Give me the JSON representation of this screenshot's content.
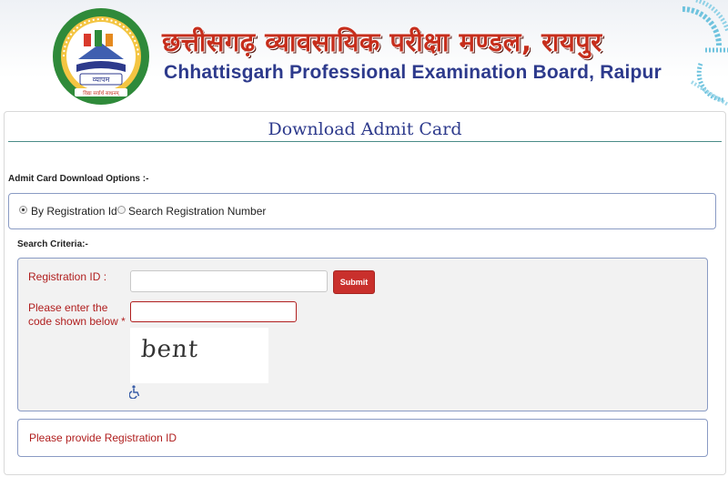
{
  "header": {
    "hindi_title": "छत्तीसगढ़ व्यावसायिक परीक्षा मण्डल, रायपुर",
    "english_title": "Chhattisgarh Professional Examination Board, Raipur",
    "logo": {
      "name": "vyapam-logo",
      "ring_text": "CHHATTISGARH PROFESSIONAL EXAMINATION BOARD",
      "center_text": "व्यापम",
      "motto": "विद्या सर्वार्थ साधनम्",
      "colors": {
        "ring": "#2f8a3a",
        "accent": "#f0a020",
        "inner": "#ffffff"
      }
    },
    "decoration_color": "#6fc3de"
  },
  "page": {
    "title": "Download Admit Card"
  },
  "options": {
    "label": "Admit Card Download Options :-",
    "radios": [
      {
        "label": "By Registration Id",
        "checked": true
      },
      {
        "label": "Search Registration Number",
        "checked": false
      }
    ]
  },
  "criteria": {
    "label": "Search Criteria:-",
    "registration_label": "Registration ID :",
    "registration_value": "",
    "submit_label": "Submit",
    "captcha_label_line1": "Please enter the",
    "captcha_label_line2": "code shown below *",
    "captcha_value": "",
    "captcha_text": "bent",
    "accessibility_icon": "wheelchair-icon"
  },
  "message": {
    "text": "Please provide Registration ID"
  },
  "colors": {
    "brand_blue": "#2d3a8c",
    "error_red": "#b01e1e",
    "submit_red": "#c9302c",
    "box_border": "#8a9bc4"
  }
}
